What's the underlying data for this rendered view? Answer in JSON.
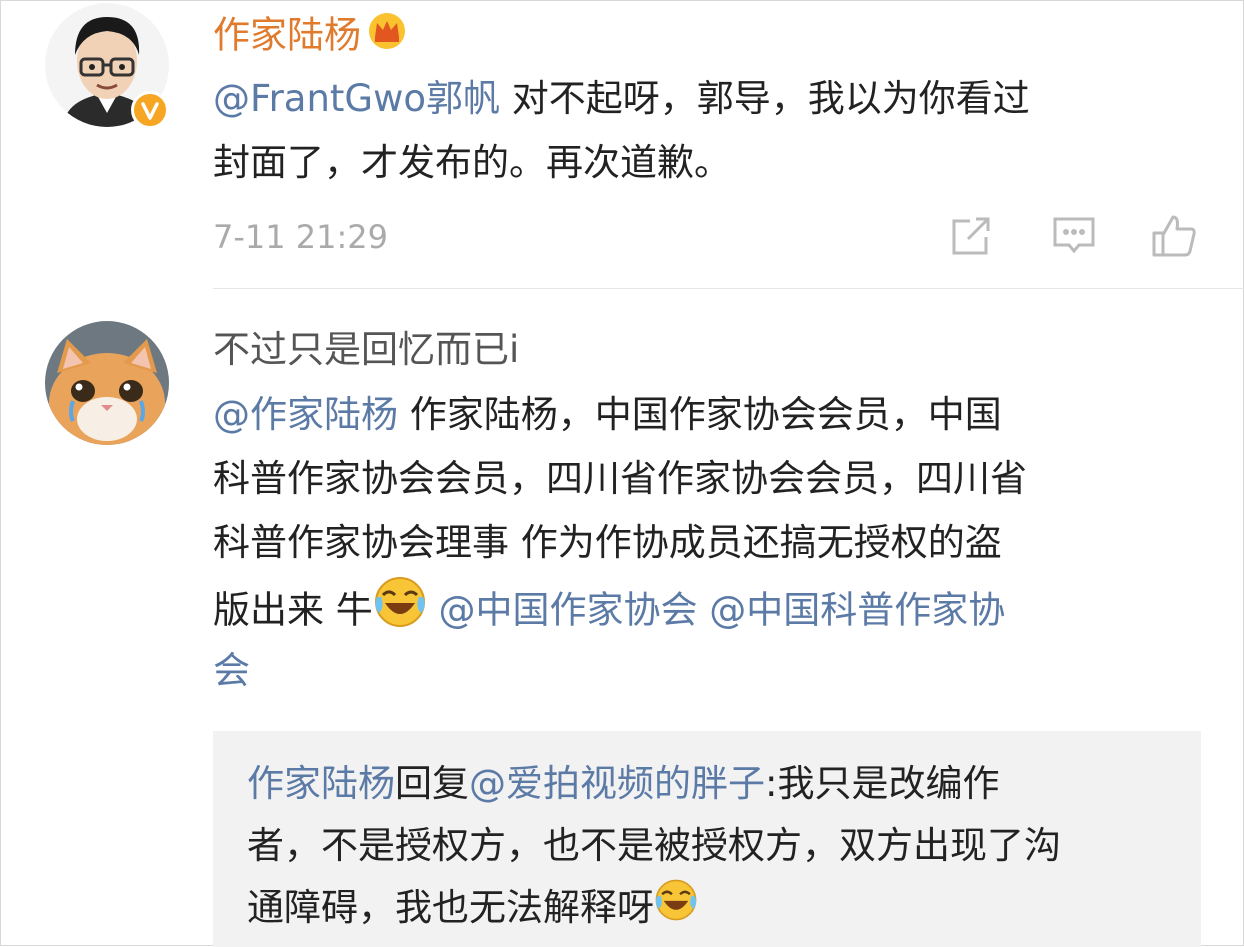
{
  "comments": [
    {
      "user": "作家陆杨",
      "lines": [
        {
          "mention": "@FrantGwo郭帆",
          "text": " 对不起呀，郭导，我以为你看过"
        },
        {
          "text": "封面了，才发布的。再次道歉。"
        }
      ],
      "time": "7-11 21:29",
      "icons": [
        "repost-icon",
        "comment-icon",
        "like-icon"
      ]
    },
    {
      "user": "不过只是回忆而已i",
      "lines": [
        {
          "mention": "@作家陆杨",
          "text": "  作家陆杨，中国作家协会会员，中国"
        },
        {
          "text": "科普作家协会会员，四川省作家协会会员，四川省"
        },
        {
          "text": "科普作家协会理事 作为作协成员还搞无授权的盗"
        },
        {
          "text": "版出来 牛",
          "mention2": " @中国作家协会 @中国科普作家协"
        },
        {
          "mention": "会"
        }
      ],
      "reply": {
        "lines": [
          {
            "mention": "作家陆杨",
            "text": "回复",
            "mention2": "@爱拍视频的胖子",
            "text2": ":我只是改编作"
          },
          {
            "text": "者，不是授权方，也不是被授权方，双方出现了沟"
          },
          {
            "text": "通障碍，我也无法解释呀"
          }
        ]
      }
    }
  ],
  "colors": {
    "mention": "#5b7aa6",
    "username_vip": "#e07b2e",
    "username": "#555555",
    "meta": "#aaaaaa",
    "badge": "#f6a623"
  }
}
